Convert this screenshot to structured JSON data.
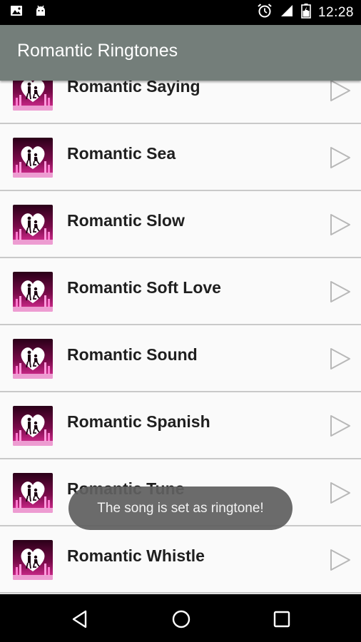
{
  "status_bar": {
    "time": "12:28",
    "left_icons": [
      "image-icon",
      "android-icon"
    ],
    "right_icons": [
      "alarm-icon",
      "signal-icon",
      "battery-charging-icon"
    ]
  },
  "app_bar": {
    "title": "Romantic Ringtones",
    "color": "#747e7a"
  },
  "list": {
    "items": [
      {
        "label": "Romantic Saying",
        "icon": "couple-heart-icon",
        "action_icon": "play-icon"
      },
      {
        "label": "Romantic Sea",
        "icon": "couple-heart-icon",
        "action_icon": "play-icon"
      },
      {
        "label": "Romantic Slow",
        "icon": "couple-heart-icon",
        "action_icon": "play-icon"
      },
      {
        "label": "Romantic Soft Love",
        "icon": "couple-heart-icon",
        "action_icon": "play-icon"
      },
      {
        "label": "Romantic Sound",
        "icon": "couple-heart-icon",
        "action_icon": "play-icon"
      },
      {
        "label": "Romantic Spanish",
        "icon": "couple-heart-icon",
        "action_icon": "play-icon"
      },
      {
        "label": "Romantic Tune",
        "icon": "couple-heart-icon",
        "action_icon": "play-icon"
      },
      {
        "label": "Romantic Whistle",
        "icon": "couple-heart-icon",
        "action_icon": "play-icon"
      }
    ]
  },
  "toast": {
    "message": "The song is set as ringtone!"
  },
  "nav_bar": {
    "buttons": [
      "back-icon",
      "home-icon",
      "recents-icon"
    ]
  }
}
